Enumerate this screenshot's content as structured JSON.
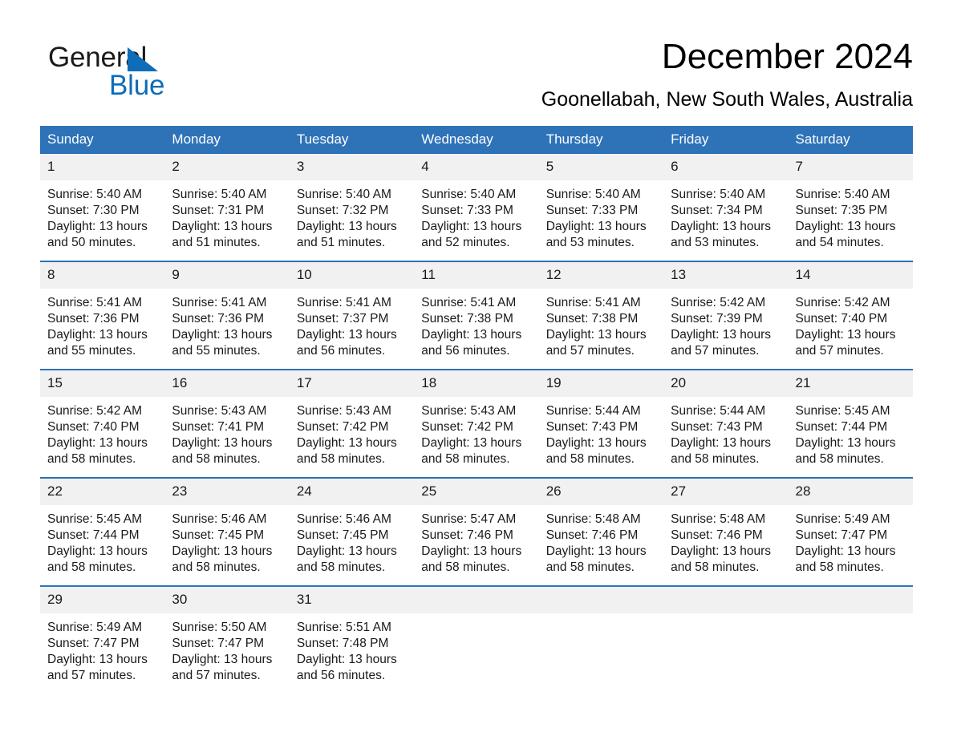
{
  "logo": {
    "word1": "General",
    "word2": "Blue",
    "triangle_color": "#0f6cb8"
  },
  "header": {
    "title": "December 2024",
    "location": "Goonellabah, New South Wales, Australia"
  },
  "theme": {
    "header_blue": "#2e72b8",
    "daynum_gray": "#f1f1f1",
    "text": "#1a1a1a"
  },
  "weekdays": [
    "Sunday",
    "Monday",
    "Tuesday",
    "Wednesday",
    "Thursday",
    "Friday",
    "Saturday"
  ],
  "weeks": [
    [
      {
        "day": "1",
        "sunrise": "Sunrise: 5:40 AM",
        "sunset": "Sunset: 7:30 PM",
        "daylight1": "Daylight: 13 hours",
        "daylight2": "and 50 minutes."
      },
      {
        "day": "2",
        "sunrise": "Sunrise: 5:40 AM",
        "sunset": "Sunset: 7:31 PM",
        "daylight1": "Daylight: 13 hours",
        "daylight2": "and 51 minutes."
      },
      {
        "day": "3",
        "sunrise": "Sunrise: 5:40 AM",
        "sunset": "Sunset: 7:32 PM",
        "daylight1": "Daylight: 13 hours",
        "daylight2": "and 51 minutes."
      },
      {
        "day": "4",
        "sunrise": "Sunrise: 5:40 AM",
        "sunset": "Sunset: 7:33 PM",
        "daylight1": "Daylight: 13 hours",
        "daylight2": "and 52 minutes."
      },
      {
        "day": "5",
        "sunrise": "Sunrise: 5:40 AM",
        "sunset": "Sunset: 7:33 PM",
        "daylight1": "Daylight: 13 hours",
        "daylight2": "and 53 minutes."
      },
      {
        "day": "6",
        "sunrise": "Sunrise: 5:40 AM",
        "sunset": "Sunset: 7:34 PM",
        "daylight1": "Daylight: 13 hours",
        "daylight2": "and 53 minutes."
      },
      {
        "day": "7",
        "sunrise": "Sunrise: 5:40 AM",
        "sunset": "Sunset: 7:35 PM",
        "daylight1": "Daylight: 13 hours",
        "daylight2": "and 54 minutes."
      }
    ],
    [
      {
        "day": "8",
        "sunrise": "Sunrise: 5:41 AM",
        "sunset": "Sunset: 7:36 PM",
        "daylight1": "Daylight: 13 hours",
        "daylight2": "and 55 minutes."
      },
      {
        "day": "9",
        "sunrise": "Sunrise: 5:41 AM",
        "sunset": "Sunset: 7:36 PM",
        "daylight1": "Daylight: 13 hours",
        "daylight2": "and 55 minutes."
      },
      {
        "day": "10",
        "sunrise": "Sunrise: 5:41 AM",
        "sunset": "Sunset: 7:37 PM",
        "daylight1": "Daylight: 13 hours",
        "daylight2": "and 56 minutes."
      },
      {
        "day": "11",
        "sunrise": "Sunrise: 5:41 AM",
        "sunset": "Sunset: 7:38 PM",
        "daylight1": "Daylight: 13 hours",
        "daylight2": "and 56 minutes."
      },
      {
        "day": "12",
        "sunrise": "Sunrise: 5:41 AM",
        "sunset": "Sunset: 7:38 PM",
        "daylight1": "Daylight: 13 hours",
        "daylight2": "and 57 minutes."
      },
      {
        "day": "13",
        "sunrise": "Sunrise: 5:42 AM",
        "sunset": "Sunset: 7:39 PM",
        "daylight1": "Daylight: 13 hours",
        "daylight2": "and 57 minutes."
      },
      {
        "day": "14",
        "sunrise": "Sunrise: 5:42 AM",
        "sunset": "Sunset: 7:40 PM",
        "daylight1": "Daylight: 13 hours",
        "daylight2": "and 57 minutes."
      }
    ],
    [
      {
        "day": "15",
        "sunrise": "Sunrise: 5:42 AM",
        "sunset": "Sunset: 7:40 PM",
        "daylight1": "Daylight: 13 hours",
        "daylight2": "and 58 minutes."
      },
      {
        "day": "16",
        "sunrise": "Sunrise: 5:43 AM",
        "sunset": "Sunset: 7:41 PM",
        "daylight1": "Daylight: 13 hours",
        "daylight2": "and 58 minutes."
      },
      {
        "day": "17",
        "sunrise": "Sunrise: 5:43 AM",
        "sunset": "Sunset: 7:42 PM",
        "daylight1": "Daylight: 13 hours",
        "daylight2": "and 58 minutes."
      },
      {
        "day": "18",
        "sunrise": "Sunrise: 5:43 AM",
        "sunset": "Sunset: 7:42 PM",
        "daylight1": "Daylight: 13 hours",
        "daylight2": "and 58 minutes."
      },
      {
        "day": "19",
        "sunrise": "Sunrise: 5:44 AM",
        "sunset": "Sunset: 7:43 PM",
        "daylight1": "Daylight: 13 hours",
        "daylight2": "and 58 minutes."
      },
      {
        "day": "20",
        "sunrise": "Sunrise: 5:44 AM",
        "sunset": "Sunset: 7:43 PM",
        "daylight1": "Daylight: 13 hours",
        "daylight2": "and 58 minutes."
      },
      {
        "day": "21",
        "sunrise": "Sunrise: 5:45 AM",
        "sunset": "Sunset: 7:44 PM",
        "daylight1": "Daylight: 13 hours",
        "daylight2": "and 58 minutes."
      }
    ],
    [
      {
        "day": "22",
        "sunrise": "Sunrise: 5:45 AM",
        "sunset": "Sunset: 7:44 PM",
        "daylight1": "Daylight: 13 hours",
        "daylight2": "and 58 minutes."
      },
      {
        "day": "23",
        "sunrise": "Sunrise: 5:46 AM",
        "sunset": "Sunset: 7:45 PM",
        "daylight1": "Daylight: 13 hours",
        "daylight2": "and 58 minutes."
      },
      {
        "day": "24",
        "sunrise": "Sunrise: 5:46 AM",
        "sunset": "Sunset: 7:45 PM",
        "daylight1": "Daylight: 13 hours",
        "daylight2": "and 58 minutes."
      },
      {
        "day": "25",
        "sunrise": "Sunrise: 5:47 AM",
        "sunset": "Sunset: 7:46 PM",
        "daylight1": "Daylight: 13 hours",
        "daylight2": "and 58 minutes."
      },
      {
        "day": "26",
        "sunrise": "Sunrise: 5:48 AM",
        "sunset": "Sunset: 7:46 PM",
        "daylight1": "Daylight: 13 hours",
        "daylight2": "and 58 minutes."
      },
      {
        "day": "27",
        "sunrise": "Sunrise: 5:48 AM",
        "sunset": "Sunset: 7:46 PM",
        "daylight1": "Daylight: 13 hours",
        "daylight2": "and 58 minutes."
      },
      {
        "day": "28",
        "sunrise": "Sunrise: 5:49 AM",
        "sunset": "Sunset: 7:47 PM",
        "daylight1": "Daylight: 13 hours",
        "daylight2": "and 58 minutes."
      }
    ],
    [
      {
        "day": "29",
        "sunrise": "Sunrise: 5:49 AM",
        "sunset": "Sunset: 7:47 PM",
        "daylight1": "Daylight: 13 hours",
        "daylight2": "and 57 minutes."
      },
      {
        "day": "30",
        "sunrise": "Sunrise: 5:50 AM",
        "sunset": "Sunset: 7:47 PM",
        "daylight1": "Daylight: 13 hours",
        "daylight2": "and 57 minutes."
      },
      {
        "day": "31",
        "sunrise": "Sunrise: 5:51 AM",
        "sunset": "Sunset: 7:48 PM",
        "daylight1": "Daylight: 13 hours",
        "daylight2": "and 56 minutes."
      },
      {
        "day": "",
        "sunrise": "",
        "sunset": "",
        "daylight1": "",
        "daylight2": ""
      },
      {
        "day": "",
        "sunrise": "",
        "sunset": "",
        "daylight1": "",
        "daylight2": ""
      },
      {
        "day": "",
        "sunrise": "",
        "sunset": "",
        "daylight1": "",
        "daylight2": ""
      },
      {
        "day": "",
        "sunrise": "",
        "sunset": "",
        "daylight1": "",
        "daylight2": ""
      }
    ]
  ]
}
